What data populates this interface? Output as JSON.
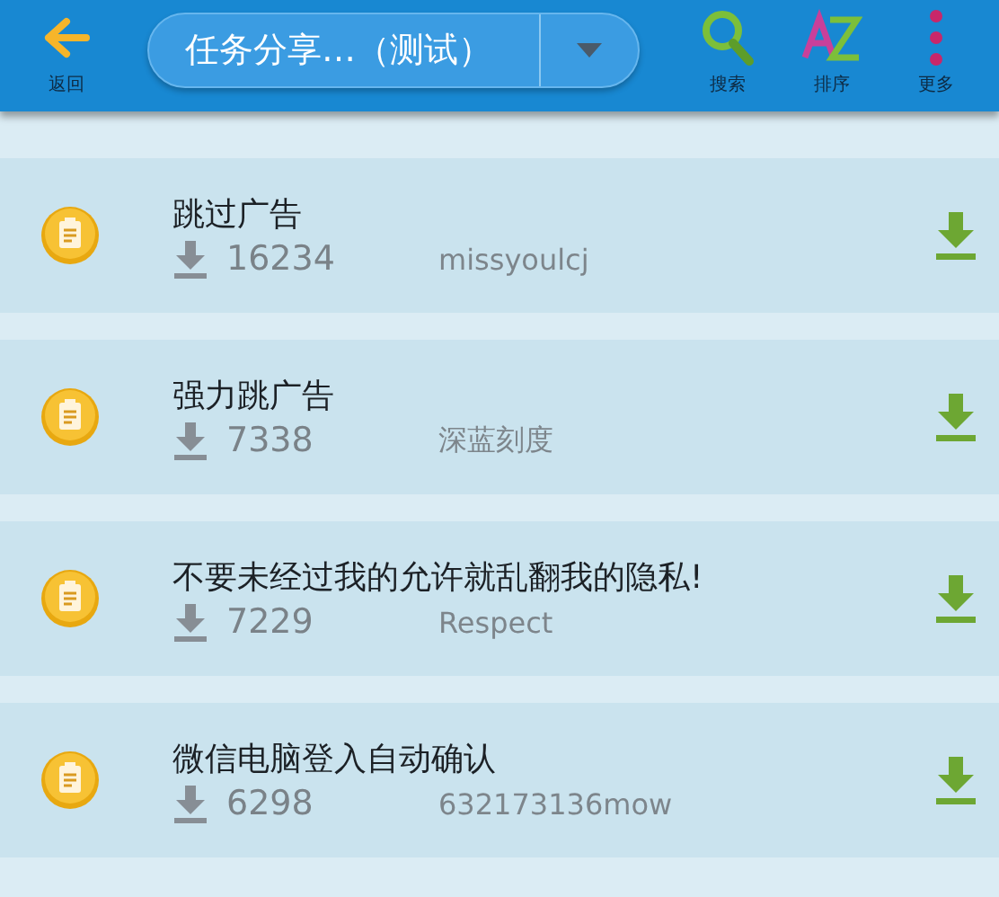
{
  "toolbar": {
    "back_label": "返回",
    "title": "任务分享…（测试）",
    "actions": [
      {
        "kind": "search",
        "label": "搜索"
      },
      {
        "kind": "sort",
        "label": "排序"
      },
      {
        "kind": "more",
        "label": "更多"
      }
    ]
  },
  "tasks": [
    {
      "title": "跳过广告",
      "downloads": "16234",
      "author": "missyoulcj"
    },
    {
      "title": "强力跳广告",
      "downloads": "7338",
      "author": "深蓝刻度"
    },
    {
      "title": "不要未经过我的允许就乱翻我的隐私!",
      "downloads": "7229",
      "author": "Respect"
    },
    {
      "title": "微信电脑登入自动确认",
      "downloads": "6298",
      "author": "632173136mow"
    }
  ]
}
